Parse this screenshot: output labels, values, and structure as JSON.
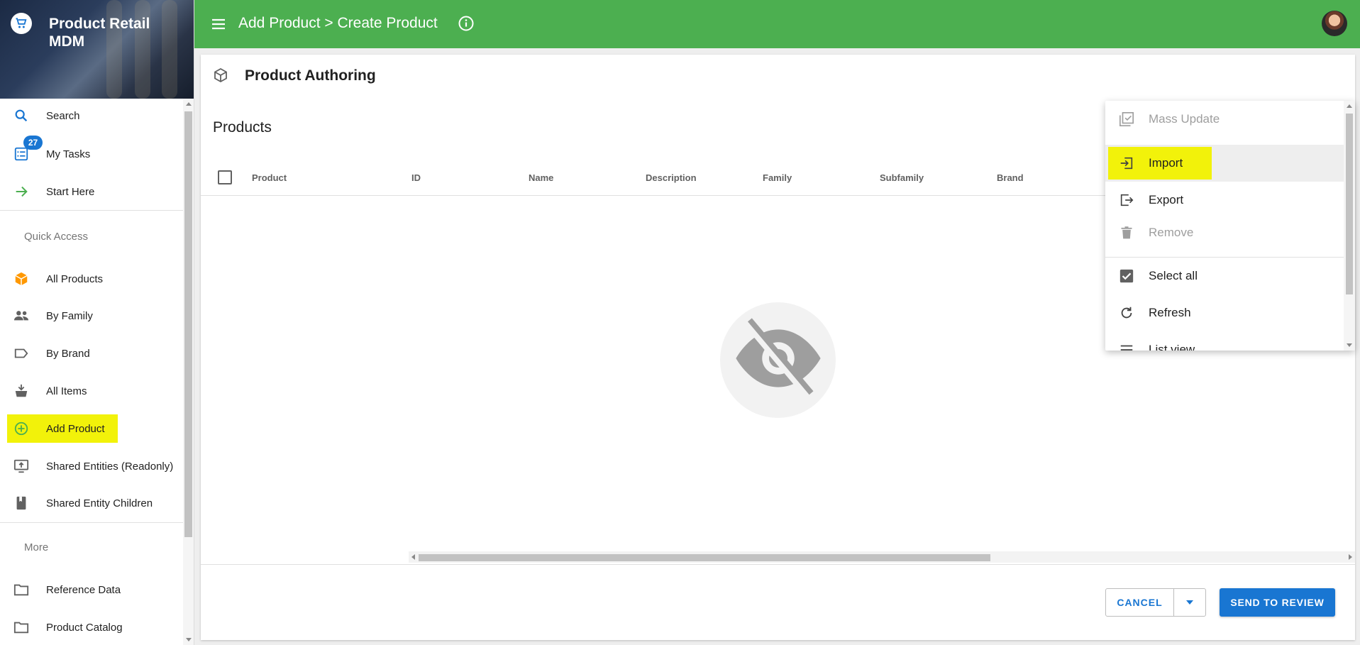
{
  "app": {
    "title": "Product Retail MDM"
  },
  "header": {
    "title": "Add Product > Create Product"
  },
  "sidebar": {
    "items": [
      {
        "label": "Search",
        "icon": "search-icon"
      },
      {
        "label": "My Tasks",
        "icon": "tasks-icon",
        "badge": "27"
      },
      {
        "label": "Start Here",
        "icon": "arrow-right-icon"
      },
      {
        "label": "All Products",
        "icon": "cube-icon"
      },
      {
        "label": "By Family",
        "icon": "people-icon"
      },
      {
        "label": "By Brand",
        "icon": "tag-icon"
      },
      {
        "label": "All Items",
        "icon": "basket-icon"
      },
      {
        "label": "Add Product",
        "icon": "add-circle-icon"
      },
      {
        "label": "Shared Entities (Readonly)",
        "icon": "monitor-upload-icon"
      },
      {
        "label": "Shared Entity Children",
        "icon": "bookmark-book-icon"
      },
      {
        "label": "Reference Data",
        "icon": "folder-icon"
      },
      {
        "label": "Product Catalog",
        "icon": "folder-icon"
      }
    ],
    "sections": {
      "quick_access": "Quick Access",
      "more": "More"
    }
  },
  "main": {
    "title": "Product Authoring",
    "section_title": "Products",
    "columns": [
      "Product",
      "ID",
      "Name",
      "Description",
      "Family",
      "Subfamily",
      "Brand"
    ]
  },
  "menu": {
    "items": [
      {
        "label": "Mass Update",
        "icon": "mass-update-icon",
        "disabled": true
      },
      {
        "label": "Import",
        "icon": "import-icon",
        "disabled": false
      },
      {
        "label": "Export",
        "icon": "export-icon",
        "disabled": false
      },
      {
        "label": "Remove",
        "icon": "trash-icon",
        "disabled": true
      },
      {
        "label": "Select all",
        "icon": "checkbox-checked-icon",
        "disabled": false
      },
      {
        "label": "Refresh",
        "icon": "refresh-icon",
        "disabled": false
      },
      {
        "label": "List view",
        "icon": "list-icon",
        "disabled": false
      }
    ]
  },
  "footer": {
    "cancel": "CANCEL",
    "send": "SEND TO REVIEW"
  },
  "colors": {
    "accent": "#4caf50",
    "primary": "#1976d2",
    "highlight": "#f2f20a"
  }
}
